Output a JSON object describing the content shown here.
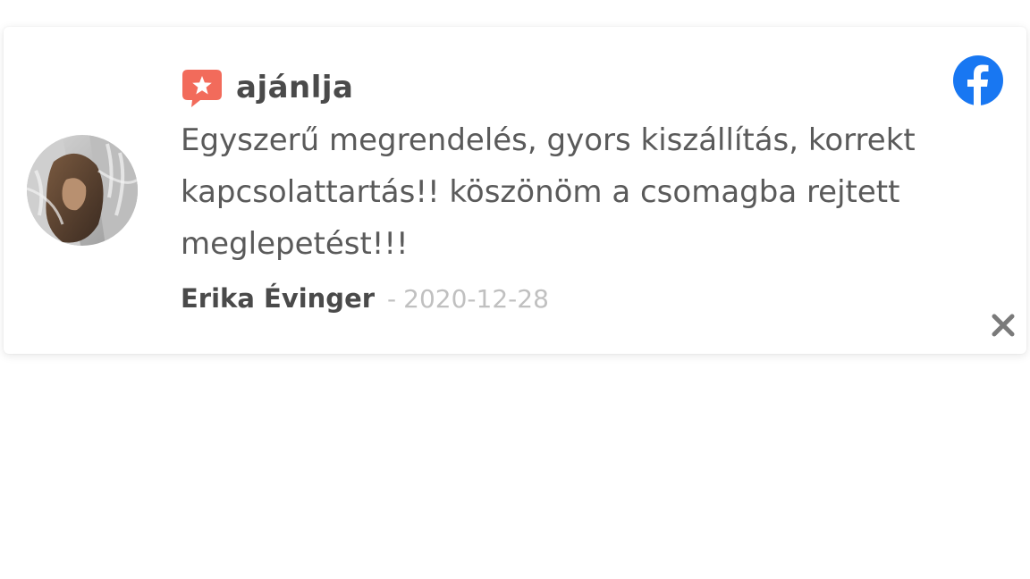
{
  "recommendation": {
    "label": "ajánlja",
    "icon": "recommend-star-bubble-icon",
    "icon_color": "#f26b5b"
  },
  "social": {
    "icon": "facebook-icon",
    "color": "#1877f2"
  },
  "review": {
    "text": "Egyszerű megrendelés, gyors kiszállítás, korrekt kapcsolattartás!! köszönöm a csomagba rejtett meglepetést!!!",
    "author": "Erika Évinger",
    "separator": "-",
    "date": "2020-12-28"
  },
  "close": {
    "icon": "close-icon"
  }
}
